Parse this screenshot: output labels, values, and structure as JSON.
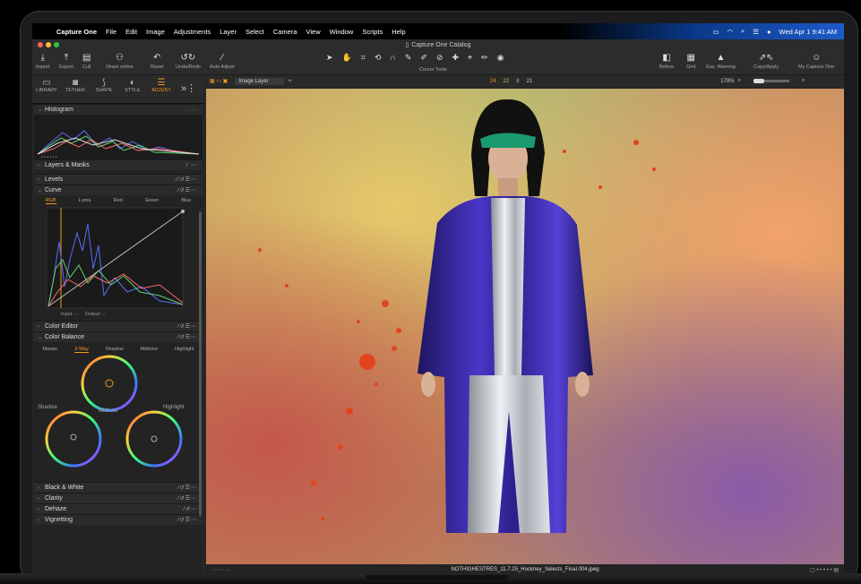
{
  "menubar": {
    "app": "Capture One",
    "items": [
      "File",
      "Edit",
      "Image",
      "Adjustments",
      "Layer",
      "Select",
      "Camera",
      "View",
      "Window",
      "Scripts",
      "Help"
    ],
    "datetime": "Wed Apr 1  9:41 AM"
  },
  "window": {
    "title": "Capture One Catalog"
  },
  "toolbar": {
    "import": "Import",
    "export": "Export",
    "cull": "Cull",
    "share": "Share online",
    "reset": "Reset",
    "undoredo": "Undo/Redo",
    "auto": "Auto Adjust",
    "cursor_tools": "Cursor Tools",
    "before": "Before",
    "grid": "Grid",
    "exp_warning": "Exp. Warning",
    "copyapply": "Copy/Apply",
    "mycaptureone": "My Capture One"
  },
  "tabs": [
    "LIBRARY",
    "TETHER",
    "SHAPE",
    "STYLE",
    "ADJUST"
  ],
  "viewer": {
    "layer": "Image Layer",
    "counts": [
      "24",
      "22",
      "8",
      "21"
    ],
    "zoom": "178%"
  },
  "panel": {
    "histogram": "Histogram",
    "layers": "Layers & Masks",
    "levels": "Levels",
    "curve": "Curve",
    "curve_tabs": [
      "RGB",
      "Luma",
      "Red",
      "Green",
      "Blue"
    ],
    "input": "Input:",
    "input_val": "--",
    "output": "Output:",
    "output_val": "--",
    "color_editor": "Color Editor",
    "color_balance": "Color Balance",
    "cb_tabs": [
      "Master",
      "3-Way",
      "Shadow",
      "Midtone",
      "Highlight"
    ],
    "shadow": "Shadow",
    "midtone": "Midtone",
    "highlight": "Highlight",
    "bw": "Black & White",
    "clarity": "Clarity",
    "dehaze": "Dehaze",
    "vignetting": "Vignetting"
  },
  "status": {
    "filename": "NOTHIGHESTRES_11.7.25_Hockney_Selects_Final.004.jpeg"
  },
  "colors": {
    "accent": "#f29a1f",
    "coat": "#3b2aa6"
  }
}
